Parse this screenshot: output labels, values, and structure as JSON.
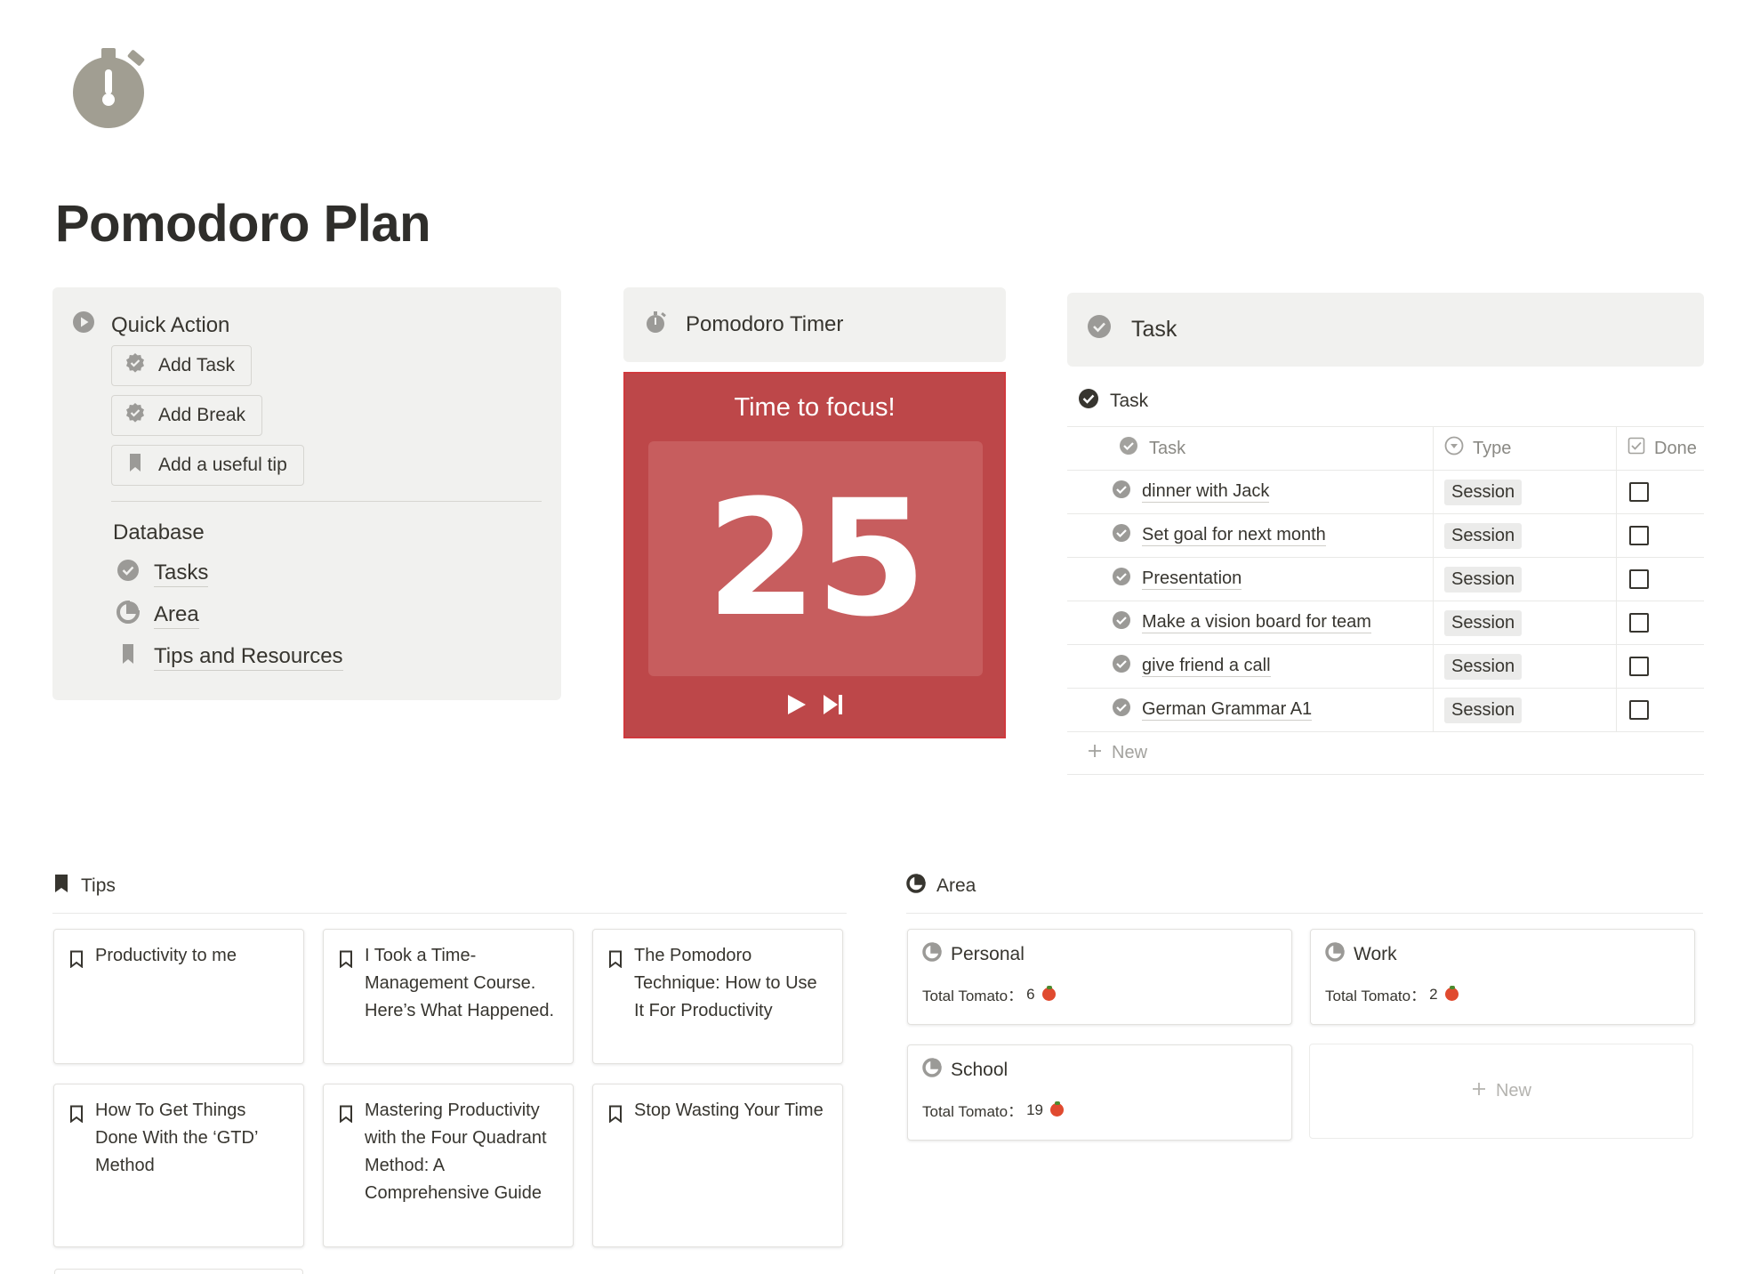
{
  "page": {
    "title": "Pomodoro Plan",
    "icon": "stopwatch-icon"
  },
  "quick_action": {
    "title": "Quick Action",
    "buttons": [
      {
        "label": "Add Task",
        "icon": "badge-check-icon"
      },
      {
        "label": "Add Break",
        "icon": "badge-check-icon"
      },
      {
        "label": "Add a useful tip",
        "icon": "bookmark-icon"
      }
    ],
    "database_heading": "Database",
    "links": [
      {
        "label": "Tasks",
        "icon": "check-circle-icon"
      },
      {
        "label": "Area",
        "icon": "pie-chart-icon"
      },
      {
        "label": "Tips and Resources",
        "icon": "bookmark-icon"
      }
    ]
  },
  "timer": {
    "title": "Pomodoro Timer",
    "label": "Time to focus!",
    "value": "25",
    "accent": "#bd4749"
  },
  "task": {
    "title": "Task",
    "view_title": "Task",
    "columns": [
      "Task",
      "Type",
      "Done"
    ],
    "rows": [
      {
        "name": "dinner with Jack",
        "type": "Session",
        "done": false
      },
      {
        "name": "Set goal for next month",
        "type": "Session",
        "done": false
      },
      {
        "name": "Presentation",
        "type": "Session",
        "done": false
      },
      {
        "name": "Make a vision board for team",
        "type": "Session",
        "done": false
      },
      {
        "name": "give friend a call",
        "type": "Session",
        "done": false
      },
      {
        "name": "German Grammar A1",
        "type": "Session",
        "done": false
      }
    ],
    "new_label": "New"
  },
  "tips": {
    "title": "Tips",
    "cards": [
      "Productivity to me",
      "I Took a Time-Management Course. Here’s What Happened.",
      "The Pomodoro Technique: How to Use It For Productivity",
      "How To Get Things Done With the ‘GTD’ Method",
      "Mastering Productivity with the Four Quadrant Method: A Comprehensive Guide",
      "Stop Wasting Your Time"
    ]
  },
  "area": {
    "title": "Area",
    "total_label": "Total Tomato：",
    "cards": [
      {
        "name": "Personal",
        "total": "6"
      },
      {
        "name": "Work",
        "total": "2"
      },
      {
        "name": "School",
        "total": "19"
      }
    ],
    "new_label": "New"
  }
}
